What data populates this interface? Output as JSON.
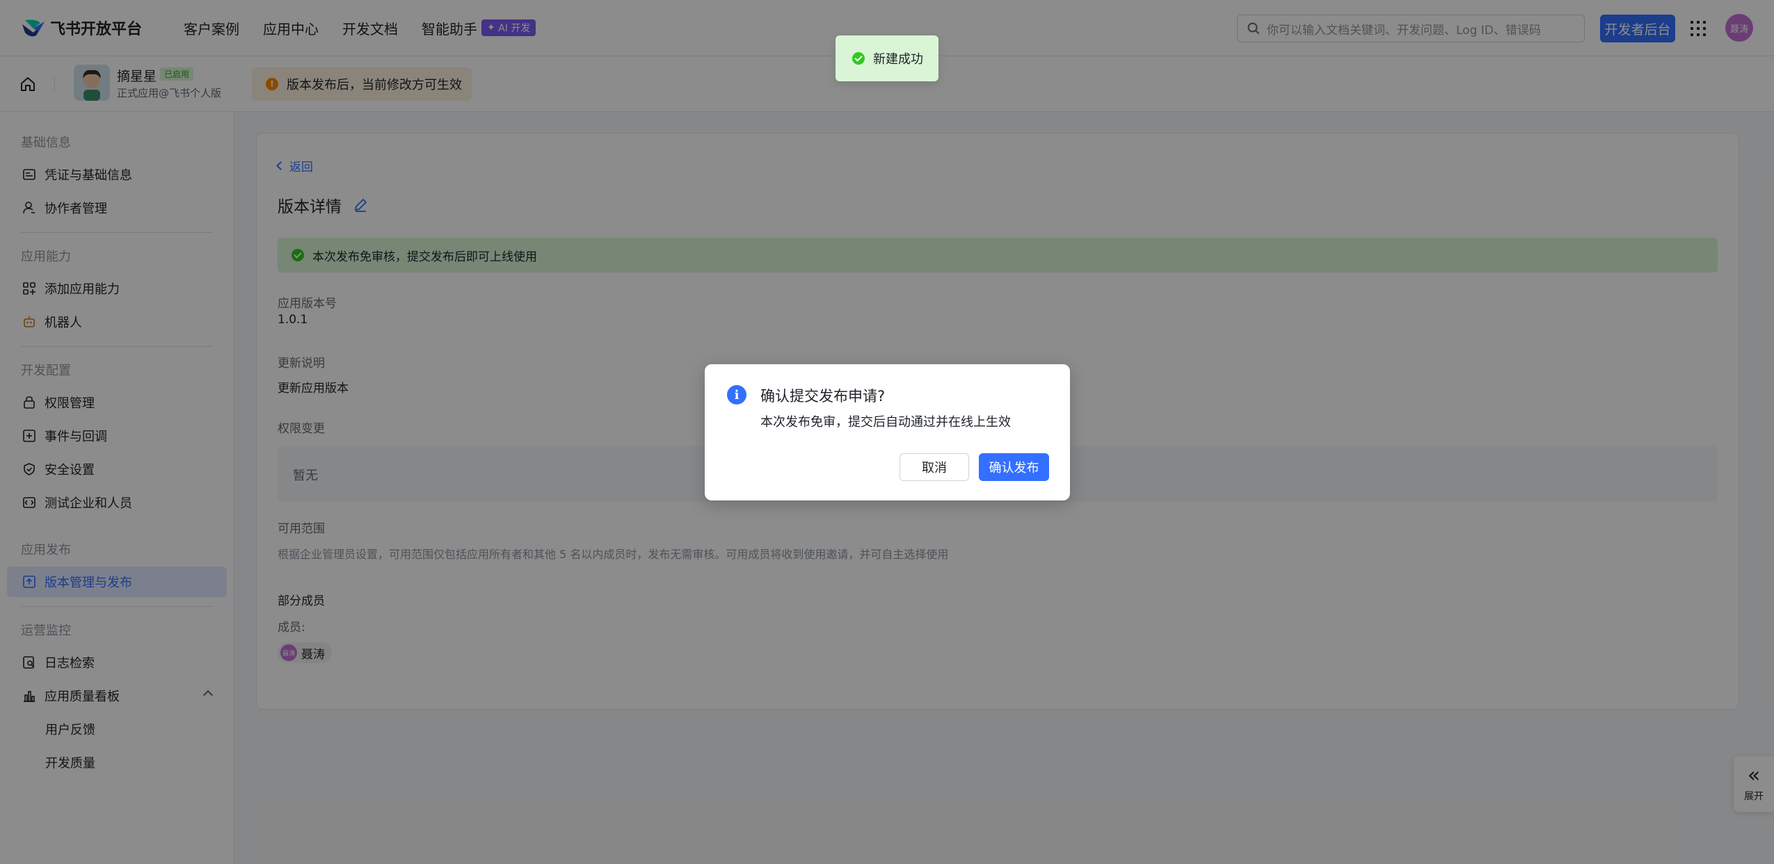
{
  "header": {
    "logo_text": "飞书开放平台",
    "nav": [
      {
        "label": "客户案例"
      },
      {
        "label": "应用中心"
      },
      {
        "label": "开发文档"
      },
      {
        "label": "智能助手"
      }
    ],
    "ai_badge": "AI 开发",
    "search_placeholder": "你可以输入文档关键词、开发问题、Log ID、错误码",
    "dev_console_label": "开发者后台",
    "user_initials": "聂涛"
  },
  "subheader": {
    "app_name": "摘星星",
    "app_status": "已启用",
    "app_subtitle": "正式应用@飞书个人版",
    "notice": "版本发布后，当前修改方可生效"
  },
  "sidebar": {
    "sections": [
      {
        "title": "基础信息",
        "items": [
          {
            "label": "凭证与基础信息",
            "icon": "credential-icon"
          },
          {
            "label": "协作者管理",
            "icon": "user-icon"
          }
        ]
      },
      {
        "title": "应用能力",
        "items": [
          {
            "label": "添加应用能力",
            "icon": "apps-add-icon"
          },
          {
            "label": "机器人",
            "icon": "robot-icon"
          }
        ]
      },
      {
        "title": "开发配置",
        "items": [
          {
            "label": "权限管理",
            "icon": "lock-icon"
          },
          {
            "label": "事件与回调",
            "icon": "event-icon"
          },
          {
            "label": "安全设置",
            "icon": "shield-icon"
          },
          {
            "label": "测试企业和人员",
            "icon": "test-icon"
          }
        ]
      },
      {
        "title": "应用发布",
        "items": [
          {
            "label": "版本管理与发布",
            "icon": "upload-icon",
            "active": true
          }
        ]
      },
      {
        "title": "运营监控",
        "items": [
          {
            "label": "日志检索",
            "icon": "log-search-icon"
          },
          {
            "label": "应用质量看板",
            "icon": "bar-chart-icon"
          },
          {
            "label": "用户反馈"
          },
          {
            "label": "开发质量"
          }
        ]
      }
    ]
  },
  "main": {
    "back_label": "返回",
    "title": "版本详情",
    "banner": "本次发布免审核，提交发布后即可上线使用",
    "version_label": "应用版本号",
    "version_value": "1.0.1",
    "notes_label": "更新说明",
    "notes_value": "更新应用版本",
    "perm_label": "权限变更",
    "perm_value": "暂无",
    "scope_label": "可用范围",
    "scope_desc": "根据企业管理员设置，可用范围仅包括应用所有者和其他 5 名以内成员时，发布无需审核。可用成员将收到使用邀请，并可自主选择使用",
    "scope_value": "部分成员",
    "members_label": "成员:",
    "member_name": "聂涛",
    "member_initials": "聂涛"
  },
  "expand_panel": {
    "label": "展开",
    "icon": "double-chevron-left-icon"
  },
  "toast": {
    "text": "新建成功"
  },
  "dialog": {
    "title": "确认提交发布申请?",
    "body": "本次发布免审，提交后自动通过并在线上生效",
    "cancel": "取消",
    "confirm": "确认发布"
  },
  "colors": {
    "accent": "#3370ff",
    "success": "#34c724",
    "warning": "#ff8800"
  }
}
